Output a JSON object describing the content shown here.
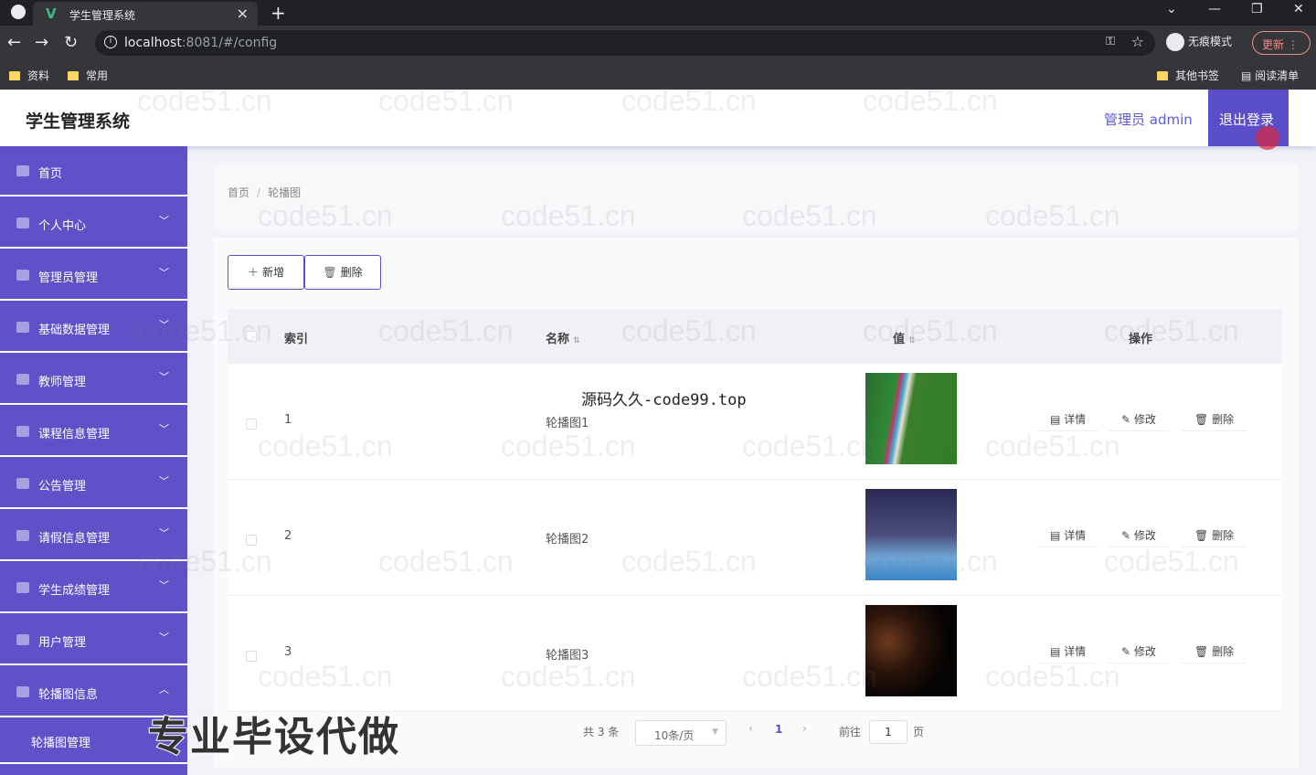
{
  "browser": {
    "tab_title": "学生管理系统",
    "tab_close": "×",
    "new_tab": "+",
    "url_host": "localhost",
    "url_rest": ":8081/#/config",
    "incognito_label": "无痕模式",
    "update_label": "更新",
    "bookmarks": [
      "资料",
      "常用"
    ],
    "bookmarks_right": [
      "其他书签",
      "阅读清单"
    ]
  },
  "header": {
    "title": "学生管理系统",
    "admin_label": "管理员 admin",
    "logout_label": "退出登录"
  },
  "sidebar": {
    "items": [
      {
        "label": "首页"
      },
      {
        "label": "个人中心"
      },
      {
        "label": "管理员管理"
      },
      {
        "label": "基础数据管理"
      },
      {
        "label": "教师管理"
      },
      {
        "label": "课程信息管理"
      },
      {
        "label": "公告管理"
      },
      {
        "label": "请假信息管理"
      },
      {
        "label": "学生成绩管理"
      },
      {
        "label": "用户管理"
      },
      {
        "label": "轮播图信息"
      }
    ],
    "submenu": {
      "label": "轮播图管理"
    }
  },
  "breadcrumb": {
    "home": "首页",
    "separator": "/",
    "current": "轮播图"
  },
  "toolbar": {
    "add_label": "新增",
    "delete_label": "删除"
  },
  "table": {
    "headers": {
      "index": "索引",
      "name": "名称",
      "value": "值",
      "actions": "操作"
    },
    "rows": [
      {
        "index": "1",
        "name": "轮播图1"
      },
      {
        "index": "2",
        "name": "轮播图2"
      },
      {
        "index": "3",
        "name": "轮播图3"
      }
    ],
    "actions": {
      "detail": "详情",
      "edit": "修改",
      "delete": "删除"
    }
  },
  "pagination": {
    "total": "共 3 条",
    "page_size": "10条/页",
    "current_page": "1",
    "goto_label": "前往",
    "goto_value": "1",
    "page_suffix": "页"
  },
  "overlays": {
    "site_url": "源码久久-code99.top",
    "ad_text": "专业毕设代做",
    "watermark": "code51.cn"
  },
  "colors": {
    "accent": "#5b4fc9",
    "sidebar": "#5f52c8"
  }
}
